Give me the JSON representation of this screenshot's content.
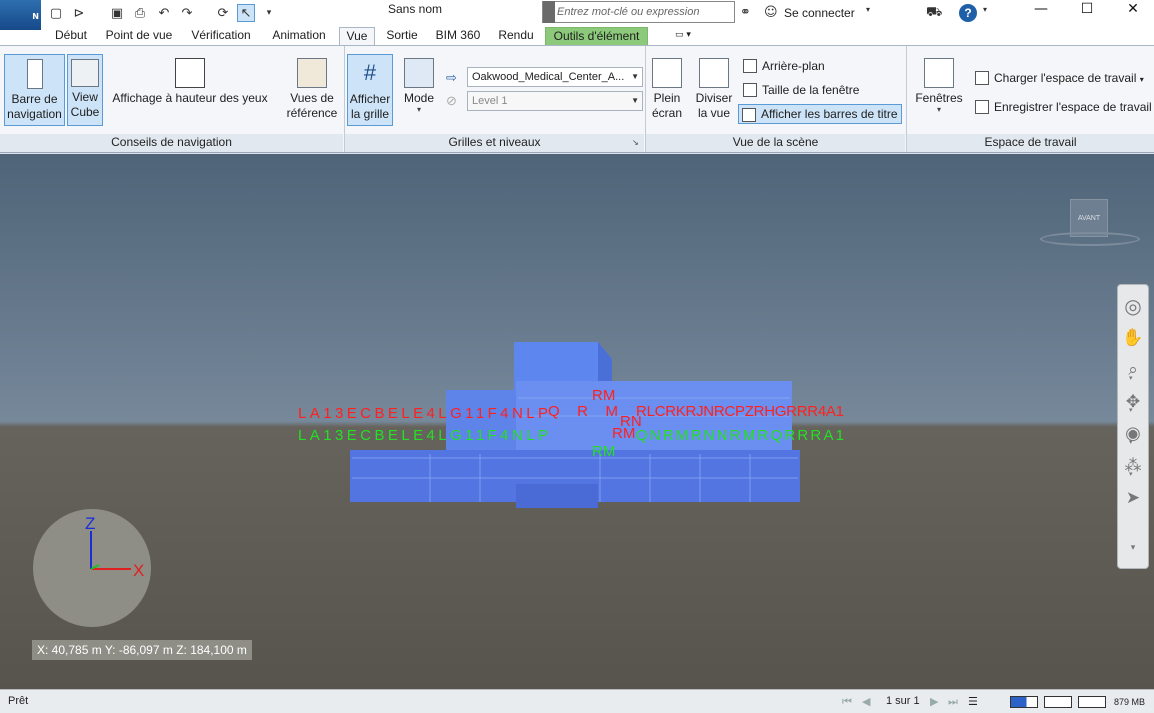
{
  "titlebar": {
    "app_letter": "N",
    "document_title": "Sans nom",
    "search_placeholder": "Entrez mot-clé ou expression",
    "sign_in": "Se connecter",
    "help": "?"
  },
  "tabs": [
    "Début",
    "Point de vue",
    "Vérification",
    "Animation",
    "Vue",
    "Sortie",
    "BIM 360",
    "Rendu",
    "Outils d'élément"
  ],
  "ribbon": {
    "nav_aids": {
      "label": "Conseils de navigation",
      "nav_bar_line1": "Barre de",
      "nav_bar_line2": "navigation",
      "view_cube_line1": "View",
      "view_cube_line2": "Cube",
      "eye_height": "Affichage à hauteur des yeux",
      "ref_views_line1": "Vues de",
      "ref_views_line2": "référence"
    },
    "grids": {
      "label": "Grilles et niveaux",
      "show_grid_line1": "Afficher",
      "show_grid_line2": "la grille",
      "mode": "Mode",
      "model_combo": "Oakwood_Medical_Center_A...",
      "level_combo": "Level 1"
    },
    "scene": {
      "label": "Vue de la scène",
      "fullscreen_line1": "Plein",
      "fullscreen_line2": "écran",
      "split_line1": "Diviser",
      "split_line2": "la vue",
      "background": "Arrière-plan",
      "window_size": "Taille de la fenêtre",
      "title_bars": "Afficher les barres de titre"
    },
    "workspace": {
      "label": "Espace de travail",
      "windows": "Fenêtres",
      "load": "Charger l'espace de travail",
      "save": "Enregistrer l'espace de travail"
    }
  },
  "viewport": {
    "viewcube_face": "AVANT",
    "axis_x": "X",
    "axis_z": "Z",
    "coords": "X: 40,785 m  Y: -86,097 m  Z: 184,100 m",
    "grid_labels_red_left": "LA13ECBELE4LG11F4NLP",
    "grid_labels_red_mid": "QRM",
    "grid_labels_red_right": "RLCRKRJNRCPZRHGRRR4A1",
    "grid_labels_green_left": "LA13ECBELE4LG11F4NLP",
    "grid_labels_green_right": "QNRMRNNRMRQRRRA1",
    "tag_rm": "RM",
    "tag_rn": "RN"
  },
  "status": {
    "ready": "Prêt",
    "page": "1 sur 1",
    "memory": "879 MB"
  }
}
